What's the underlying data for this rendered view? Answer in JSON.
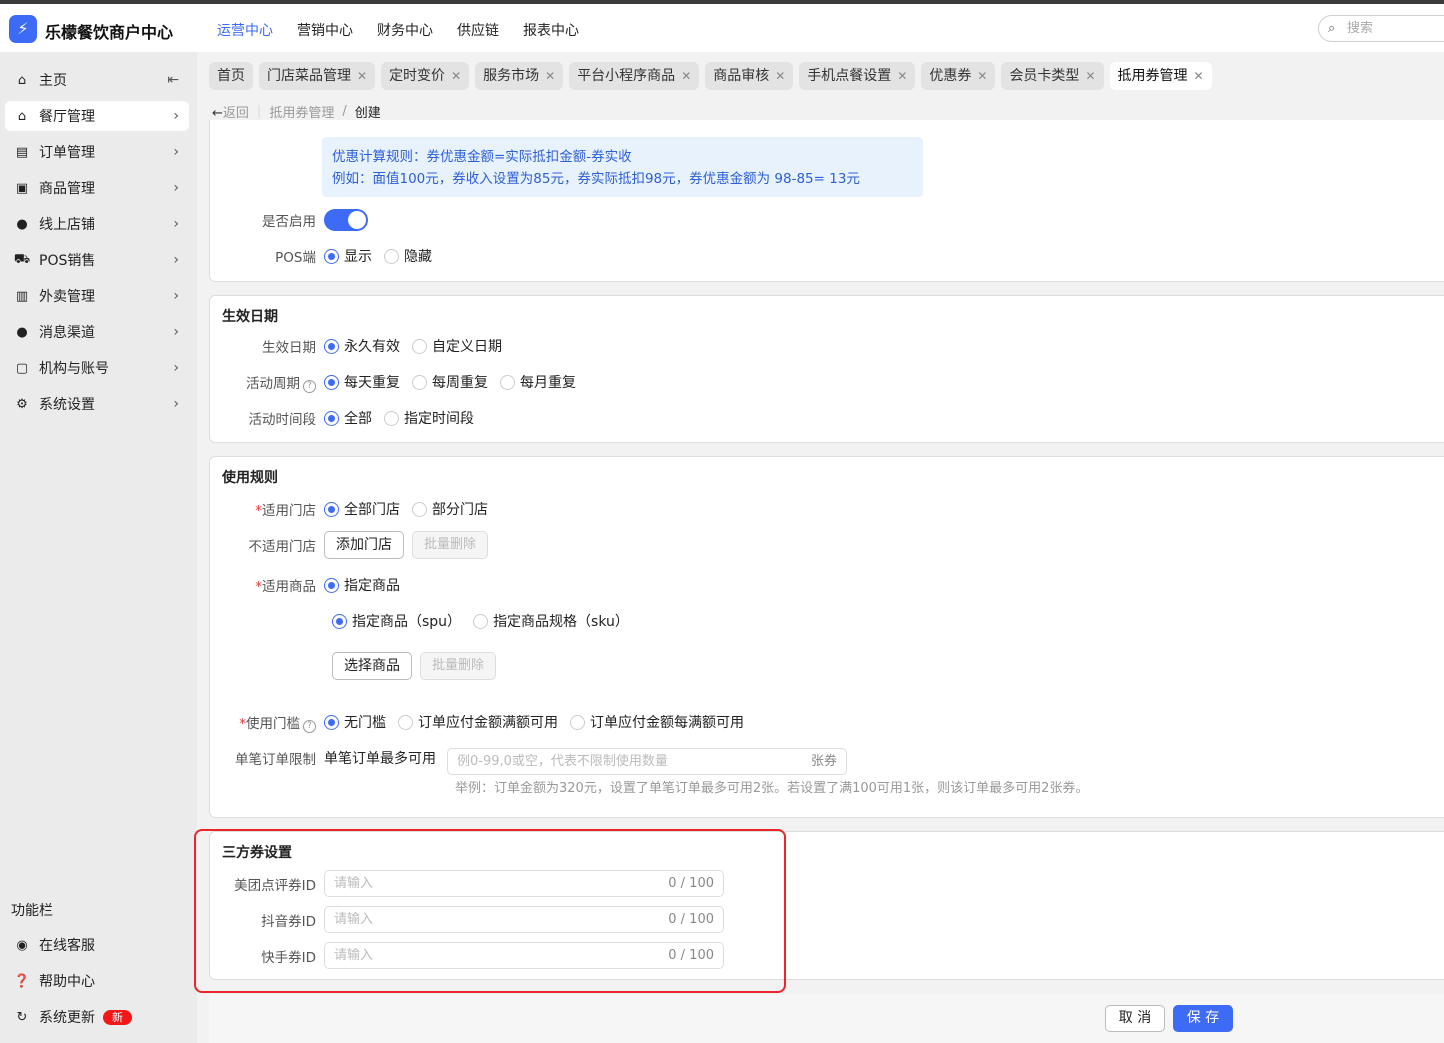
{
  "header": {
    "brand": "乐檬餐饮商户中心",
    "nav": [
      "运营中心",
      "营销中心",
      "财务中心",
      "供应链",
      "报表中心"
    ],
    "search_placeholder": "搜索"
  },
  "sidebar": {
    "items": [
      {
        "label": "主页",
        "icon": "home-icon"
      },
      {
        "label": "餐厅管理",
        "icon": "store-icon"
      },
      {
        "label": "订单管理",
        "icon": "order-icon"
      },
      {
        "label": "商品管理",
        "icon": "goods-icon"
      },
      {
        "label": "线上店铺",
        "icon": "globe-icon"
      },
      {
        "label": "POS销售",
        "icon": "cart-icon"
      },
      {
        "label": "外卖管理",
        "icon": "delivery-icon"
      },
      {
        "label": "消息渠道",
        "icon": "message-icon"
      },
      {
        "label": "机构与账号",
        "icon": "account-icon"
      },
      {
        "label": "系统设置",
        "icon": "gear-icon"
      }
    ],
    "func_title": "功能栏",
    "func": [
      {
        "label": "在线客服"
      },
      {
        "label": "帮助中心"
      },
      {
        "label": "系统更新",
        "badge": "新"
      }
    ]
  },
  "tabs": [
    "首页",
    "门店菜品管理",
    "定时变价",
    "服务市场",
    "平台小程序商品",
    "商品审核",
    "手机点餐设置",
    "优惠券",
    "会员卡类型",
    "抵用券管理"
  ],
  "breadcrumb": {
    "back": "返回",
    "parent": "抵用券管理",
    "current": "创建"
  },
  "info": {
    "line1": "优惠计算规则：券优惠金额=实际抵扣金额-券实收",
    "line2": "例如：面值100元，券收入设置为85元，券实际抵扣98元，券优惠金额为 98-85= 13元"
  },
  "basic": {
    "enable_label": "是否启用",
    "enabled": true,
    "pos_label": "POS端",
    "pos_options": [
      "显示",
      "隐藏"
    ]
  },
  "validity": {
    "title": "生效日期",
    "date_label": "生效日期",
    "date_options": [
      "永久有效",
      "自定义日期"
    ],
    "cycle_label": "活动周期",
    "cycle_options": [
      "每天重复",
      "每周重复",
      "每月重复"
    ],
    "time_label": "活动时间段",
    "time_options": [
      "全部",
      "指定时间段"
    ]
  },
  "rules": {
    "title": "使用规则",
    "store_label": "适用门店",
    "store_options": [
      "全部门店",
      "部分门店"
    ],
    "excl_label": "不适用门店",
    "add_store": "添加门店",
    "batch_delete": "批量删除",
    "goods_label": "适用商品",
    "goods_option": "指定商品",
    "spu": "指定商品（spu）",
    "sku": "指定商品规格（sku）",
    "select_goods": "选择商品",
    "threshold_label": "使用门槛",
    "threshold_options": [
      "无门槛",
      "订单应付金额满额可用",
      "订单应付金额每满额可用"
    ],
    "limit_label": "单笔订单限制",
    "limit_prefix": "单笔订单最多可用",
    "limit_placeholder": "例0-99,0或空，代表不限制使用数量",
    "limit_suffix": "张券",
    "limit_hint": "举例：订单金额为320元，设置了单笔订单最多可用2张。若设置了满100可用1张，则该订单最多可用2张券。"
  },
  "thirdparty": {
    "title": "三方券设置",
    "fields": [
      {
        "label": "美团点评券ID",
        "placeholder": "请输入",
        "count": "0 / 100"
      },
      {
        "label": "抖音券ID",
        "placeholder": "请输入",
        "count": "0 / 100"
      },
      {
        "label": "快手券ID",
        "placeholder": "请输入",
        "count": "0 / 100"
      }
    ]
  },
  "footer": {
    "cancel": "取 消",
    "save": "保 存"
  }
}
